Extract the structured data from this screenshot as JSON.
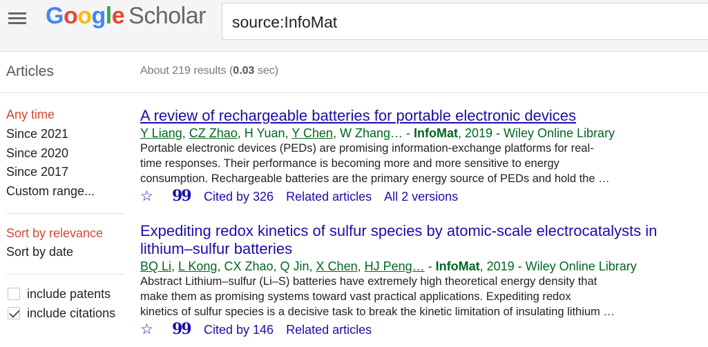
{
  "header": {
    "logo_google": [
      "G",
      "o",
      "o",
      "g",
      "l",
      "e"
    ],
    "logo_scholar": "Scholar",
    "search_value": "source:InfoMat"
  },
  "toolbar": {
    "section": "Articles",
    "results_prefix": "About 219 results (",
    "results_time": "0.03",
    "results_suffix": " sec)"
  },
  "sidebar": {
    "time_filters": [
      "Any time",
      "Since 2021",
      "Since 2020",
      "Since 2017",
      "Custom range..."
    ],
    "sort_options": [
      "Sort by relevance",
      "Sort by date"
    ],
    "checkboxes": [
      {
        "label": "include patents",
        "checked": false
      },
      {
        "label": "include citations",
        "checked": true
      }
    ]
  },
  "results": [
    {
      "title": "A review of rechargeable batteries for portable electronic devices",
      "authors": [
        "Y Liang",
        "CZ Zhao",
        "H Yuan",
        "Y Chen",
        "W Zhang…"
      ],
      "journal": "InfoMat",
      "year_source": ", 2019 - Wiley Online Library",
      "snippet": [
        "Portable electronic devices (PEDs) are promising information-exchange platforms for real-",
        "time responses. Their performance is becoming more and more sensitive to energy",
        "consumption. Rechargeable batteries are the primary energy source of PEDs and hold the …"
      ],
      "cited_by": "Cited by 326",
      "related": "Related articles",
      "versions": "All 2 versions"
    },
    {
      "title_line1": "Expediting redox kinetics of sulfur species by atomic-scale electrocatalysts in",
      "title_line2": "lithium–sulfur batteries",
      "authors": [
        "BQ Li",
        "L Kong",
        "CX Zhao",
        "Q Jin",
        "X Chen",
        "HJ Peng…"
      ],
      "journal": "InfoMat",
      "year_source": ", 2019 - Wiley Online Library",
      "snippet": [
        "Abstract Lithium–sulfur (Li–S) batteries have extremely high theoretical energy density that",
        "make them as promising systems toward vast practical applications. Expediting redox",
        "kinetics of sulfur species is a decisive task to break the kinetic limitation of insulating lithium …"
      ],
      "cited_by": "Cited by 146",
      "related": "Related articles"
    }
  ],
  "icons": {
    "star": "☆",
    "quote": "99"
  }
}
